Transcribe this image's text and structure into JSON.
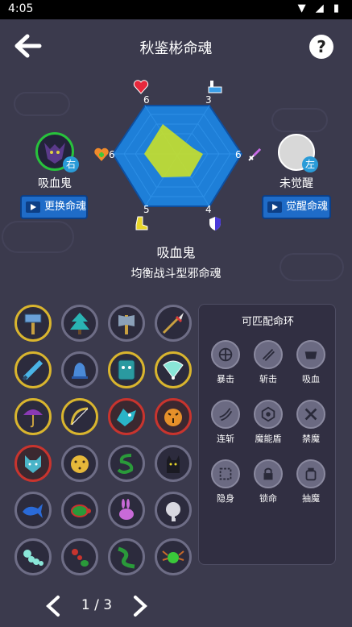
{
  "status": {
    "time": "4:05"
  },
  "header": {
    "title": "秋鉴彬命魂"
  },
  "radar": {
    "stats": [
      {
        "icon": "heart-icon",
        "value": "6"
      },
      {
        "icon": "potion-icon",
        "value": "3"
      },
      {
        "icon": "sword-icon",
        "value": "6"
      },
      {
        "icon": "shield-icon",
        "value": "4"
      },
      {
        "icon": "boot-icon",
        "value": "5"
      },
      {
        "icon": "heal-icon",
        "value": "6"
      }
    ]
  },
  "left_soul": {
    "name": "吸血鬼",
    "badge": "右",
    "button": "更换命魂"
  },
  "right_soul": {
    "name": "未觉醒",
    "badge": "左",
    "button": "觉醒命魂"
  },
  "soul": {
    "name": "吸血鬼",
    "description": "均衡战斗型邪命魂"
  },
  "grid_icons": [
    "hammer-icon",
    "pine-tree-icon",
    "axe-icon",
    "spear-icon",
    "sword-blade-icon",
    "bell-icon",
    "tribal-shield-icon",
    "fan-icon",
    "umbrella-icon",
    "bow-icon",
    "dragon-icon",
    "tiger-icon",
    "wolf-icon",
    "leopard-icon",
    "snake-icon",
    "black-cat-icon",
    "whale-icon",
    "turtle-icon",
    "rabbit-icon",
    "elephant-icon",
    "caterpillar-icon",
    "ant-icon",
    "centipede-icon",
    "spider-icon"
  ],
  "rings": {
    "title": "可匹配命环",
    "items": [
      {
        "label": "暴击",
        "icon": "critical-icon"
      },
      {
        "label": "斩击",
        "icon": "slash-icon"
      },
      {
        "label": "吸血",
        "icon": "bite-icon"
      },
      {
        "label": "连斩",
        "icon": "combo-slash-icon"
      },
      {
        "label": "魔能盾",
        "icon": "magic-shield-icon"
      },
      {
        "label": "禁魔",
        "icon": "silence-icon"
      },
      {
        "label": "隐身",
        "icon": "stealth-icon"
      },
      {
        "label": "锁命",
        "icon": "lock-life-icon"
      },
      {
        "label": "抽魔",
        "icon": "drain-magic-icon"
      }
    ]
  },
  "pager": {
    "label": "1 / 3"
  },
  "colors": {
    "background": "#3b3a4d",
    "button": "#1f6cc8",
    "badge": "#2a9bd8",
    "radar_fill": "#c8e02a",
    "radar_base": "#1e7fd8"
  }
}
